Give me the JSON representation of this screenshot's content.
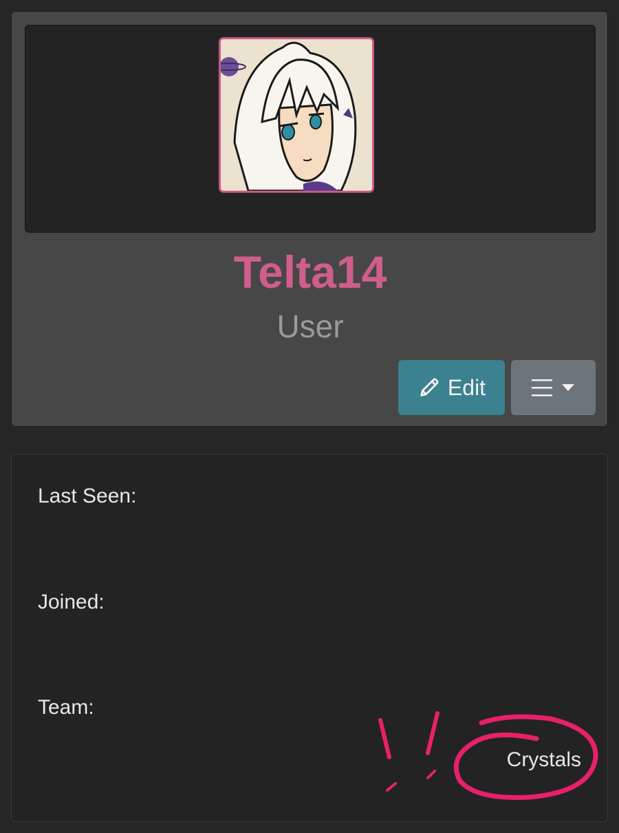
{
  "profile": {
    "username": "Telta14",
    "role": "User",
    "avatar_icon": "anime-avatar-image",
    "accent_color": "#cf5e8b",
    "edit_button": {
      "label": "Edit",
      "icon": "pencil-icon",
      "color": "#3b8190"
    },
    "menu_button": {
      "icon": "hamburger-menu-icon",
      "caret": "caret-down-icon",
      "color": "#6c757c"
    }
  },
  "info": {
    "last_seen_label": "Last Seen:",
    "joined_label": "Joined:",
    "team_label": "Team:",
    "team_value": "Crystals"
  },
  "annotation": {
    "color": "#e8206a"
  }
}
